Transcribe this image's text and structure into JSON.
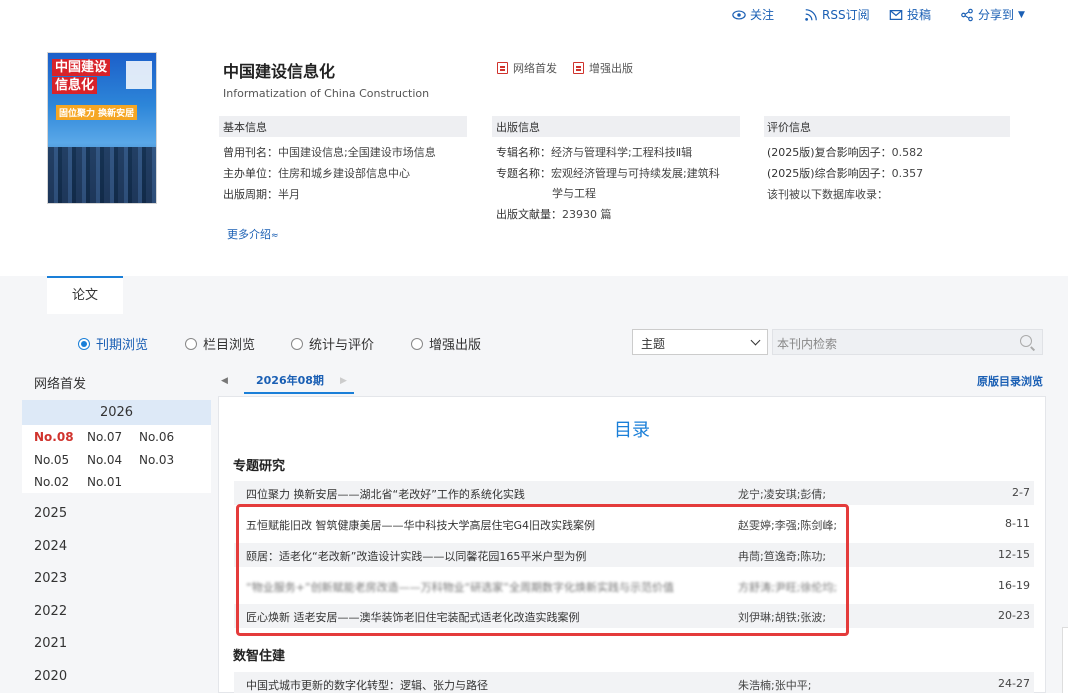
{
  "topbar": {
    "follow": "关注",
    "rss": "RSS订阅",
    "submit": "投稿",
    "share": "分享到"
  },
  "journal": {
    "cn_title": "中国建设信息化",
    "en_title": "Informatization of China Construction",
    "badge_first": "网络首发",
    "badge_enhanced": "增强出版",
    "cover_line1": "中国建设",
    "cover_line2": "信息化",
    "cover_tag": "固位聚力 换新安居",
    "basic": {
      "head": "基本信息",
      "former_label": "曾用刊名：",
      "former_value": "中国建设信息;全国建设市场信息",
      "sponsor_label": "主办单位：",
      "sponsor_value": "住房和城乡建设部信息中心",
      "cycle_label": "出版周期：",
      "cycle_value": "半月"
    },
    "publish": {
      "head": "出版信息",
      "series_label": "专辑名称：",
      "series_value": "经济与管理科学;工程科技Ⅱ辑",
      "topic_label": "专题名称：",
      "topic_value1": "宏观经济管理与可持续发展;建筑科",
      "topic_value2": "学与工程",
      "count_label": "出版文献量：",
      "count_value": "23930 篇"
    },
    "eval": {
      "head": "评价信息",
      "composite_label": "(2025版)复合影响因子：",
      "composite_value": "0.582",
      "overall_label": "(2025版)综合影响因子：",
      "overall_value": "0.357",
      "db_label": "该刊被以下数据库收录："
    },
    "more": "更多介绍"
  },
  "tabs": {
    "papers": "论文"
  },
  "filters": {
    "issue_browse": "刊期浏览",
    "column_browse": "栏目浏览",
    "stats": "统计与评价",
    "enhanced": "增强出版",
    "select_value": "主题",
    "search_placeholder": "本刊内检索"
  },
  "sidebar": {
    "title": "网络首发",
    "current_year": "2026",
    "issues": [
      "No.08",
      "No.07",
      "No.06",
      "No.05",
      "No.04",
      "No.03",
      "No.02",
      "No.01"
    ],
    "years": [
      "2025",
      "2024",
      "2023",
      "2022",
      "2021",
      "2020"
    ]
  },
  "content": {
    "issue_label": "2026年08期",
    "orig_link": "原版目录浏览",
    "toc_title": "目录",
    "section1": "专题研究",
    "section2": "数智住建",
    "rows": [
      {
        "title": "四位聚力 换新安居——湖北省“老改好”工作的系统化实践",
        "authors": "龙宁;凌安琪;彭倩;",
        "pages": "2-7"
      },
      {
        "title": "五恒赋能旧改 智筑健康美居——华中科技大学高层住宅G4旧改实践案例",
        "authors": "赵雯婷;李强;陈剑峰;",
        "pages": "8-11"
      },
      {
        "title": "颐居：适老化“老改新”改造设计实践——以同馨花园165平米户型为例",
        "authors": "冉茼;笪逸奇;陈功;",
        "pages": "12-15"
      },
      {
        "title": "“物业服务+”创新赋能老房改造——万科物业“研选家”全周期数字化焕新实践与示范价值",
        "authors": "方舒涛;尹旺;徐伦均;",
        "pages": "16-19"
      },
      {
        "title": "匠心焕新 适老安居——澳华装饰老旧住宅装配式适老化改造实践案例",
        "authors": "刘伊琳;胡铁;张波;",
        "pages": "20-23"
      },
      {
        "title": "中国式城市更新的数字化转型：逻辑、张力与路径",
        "authors": "朱浩楠;张中平;",
        "pages": "24-27"
      }
    ]
  },
  "colors": {
    "accent": "#1a7fd8",
    "link": "#1a5fb4",
    "highlight": "#e43b3b",
    "selected_issue": "#d0332d"
  }
}
